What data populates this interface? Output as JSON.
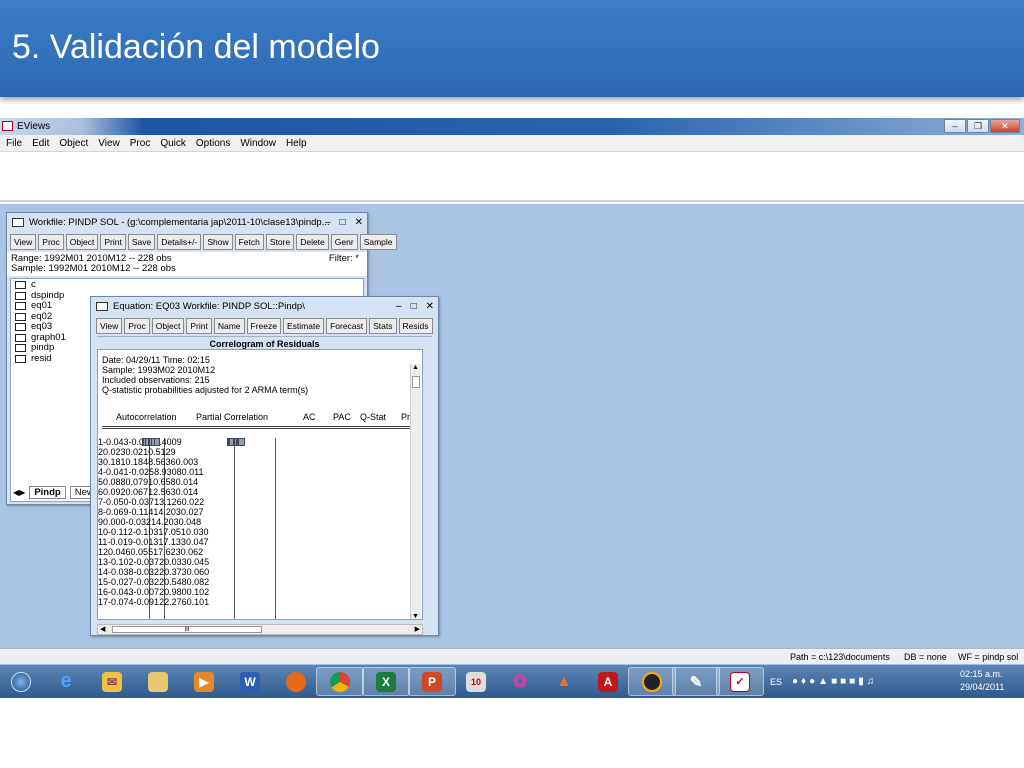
{
  "slide": {
    "title": "5. Validación del modelo"
  },
  "app": {
    "title": "EViews",
    "menu": [
      "File",
      "Edit",
      "Object",
      "View",
      "Proc",
      "Quick",
      "Options",
      "Window",
      "Help"
    ]
  },
  "workfile": {
    "title": "Workfile: PINDP SOL - (g:\\complementaria jap\\2011-10\\clase13\\pindp...",
    "toolbar": [
      "View",
      "Proc",
      "Object",
      "Print",
      "Save",
      "Details+/-",
      "Show",
      "Fetch",
      "Store",
      "Delete",
      "Genr",
      "Sample"
    ],
    "range": "Range:  1992M01 2010M12  --  228 obs",
    "sample": "Sample: 1992M01 2010M12  --  228 obs",
    "filter": "Filter: *",
    "objects": [
      "c",
      "dspindp",
      "eq01",
      "eq02",
      "eq03",
      "graph01",
      "pindp",
      "resid"
    ],
    "tabs": [
      "Pindp",
      "New"
    ]
  },
  "equation": {
    "title": "Equation: EQ03   Workfile: PINDP SOL::Pindp\\",
    "toolbar": [
      "View",
      "Proc",
      "Object",
      "Print",
      "Name",
      "Freeze",
      "Estimate",
      "Forecast",
      "Stats",
      "Resids"
    ],
    "band": "Correlogram of Residuals",
    "header": [
      "Date: 04/29/11   Time: 02:15",
      "Sample: 1993M02 2010M12",
      "Included observations: 215",
      "Q-statistic probabilities adjusted for 2 ARMA term(s)"
    ],
    "columns": [
      "Autocorrelation",
      "Partial Correlation",
      "AC",
      "PAC",
      "Q-Stat",
      "Prob"
    ],
    "rows": [
      {
        "lag": "1",
        "ac": "-0.043",
        "pac": "-0.043",
        "q": "0.4009",
        "p": ""
      },
      {
        "lag": "2",
        "ac": "0.023",
        "pac": "0.021",
        "q": "0.5129",
        "p": ""
      },
      {
        "lag": "3",
        "ac": "0.181",
        "pac": "0.184",
        "q": "8.5636",
        "p": "0.003"
      },
      {
        "lag": "4",
        "ac": "-0.041",
        "pac": "-0.025",
        "q": "8.9308",
        "p": "0.011"
      },
      {
        "lag": "5",
        "ac": "0.088",
        "pac": "0.079",
        "q": "10.658",
        "p": "0.014"
      },
      {
        "lag": "6",
        "ac": "0.092",
        "pac": "0.067",
        "q": "12.563",
        "p": "0.014"
      },
      {
        "lag": "7",
        "ac": "-0.050",
        "pac": "-0.037",
        "q": "13.126",
        "p": "0.022"
      },
      {
        "lag": "8",
        "ac": "-0.069",
        "pac": "-0.114",
        "q": "14.203",
        "p": "0.027"
      },
      {
        "lag": "9",
        "ac": "0.000",
        "pac": "-0.032",
        "q": "14.203",
        "p": "0.048"
      },
      {
        "lag": "10",
        "ac": "-0.112",
        "pac": "-0.103",
        "q": "17.051",
        "p": "0.030"
      },
      {
        "lag": "11",
        "ac": "-0.019",
        "pac": "-0.013",
        "q": "17.133",
        "p": "0.047"
      },
      {
        "lag": "12",
        "ac": "0.046",
        "pac": "0.055",
        "q": "17.623",
        "p": "0.062"
      },
      {
        "lag": "13",
        "ac": "-0.102",
        "pac": "-0.037",
        "q": "20.033",
        "p": "0.045"
      },
      {
        "lag": "14",
        "ac": "-0.038",
        "pac": "-0.032",
        "q": "20.373",
        "p": "0.060"
      },
      {
        "lag": "15",
        "ac": "-0.027",
        "pac": "-0.032",
        "q": "20.548",
        "p": "0.082"
      },
      {
        "lag": "16",
        "ac": "-0.043",
        "pac": "-0.007",
        "q": "20.980",
        "p": "0.102"
      },
      {
        "lag": "17",
        "ac": "-0.074",
        "pac": "-0.091",
        "q": "22.276",
        "p": "0.101"
      }
    ],
    "scroll_label": "III"
  },
  "status": {
    "path": "Path = c:\\123\\documents",
    "db": "DB = none",
    "wf": "WF = pindp sol"
  },
  "taskbar": {
    "lang": "ES",
    "time": "02:15 a.m.",
    "date": "29/04/2011"
  }
}
